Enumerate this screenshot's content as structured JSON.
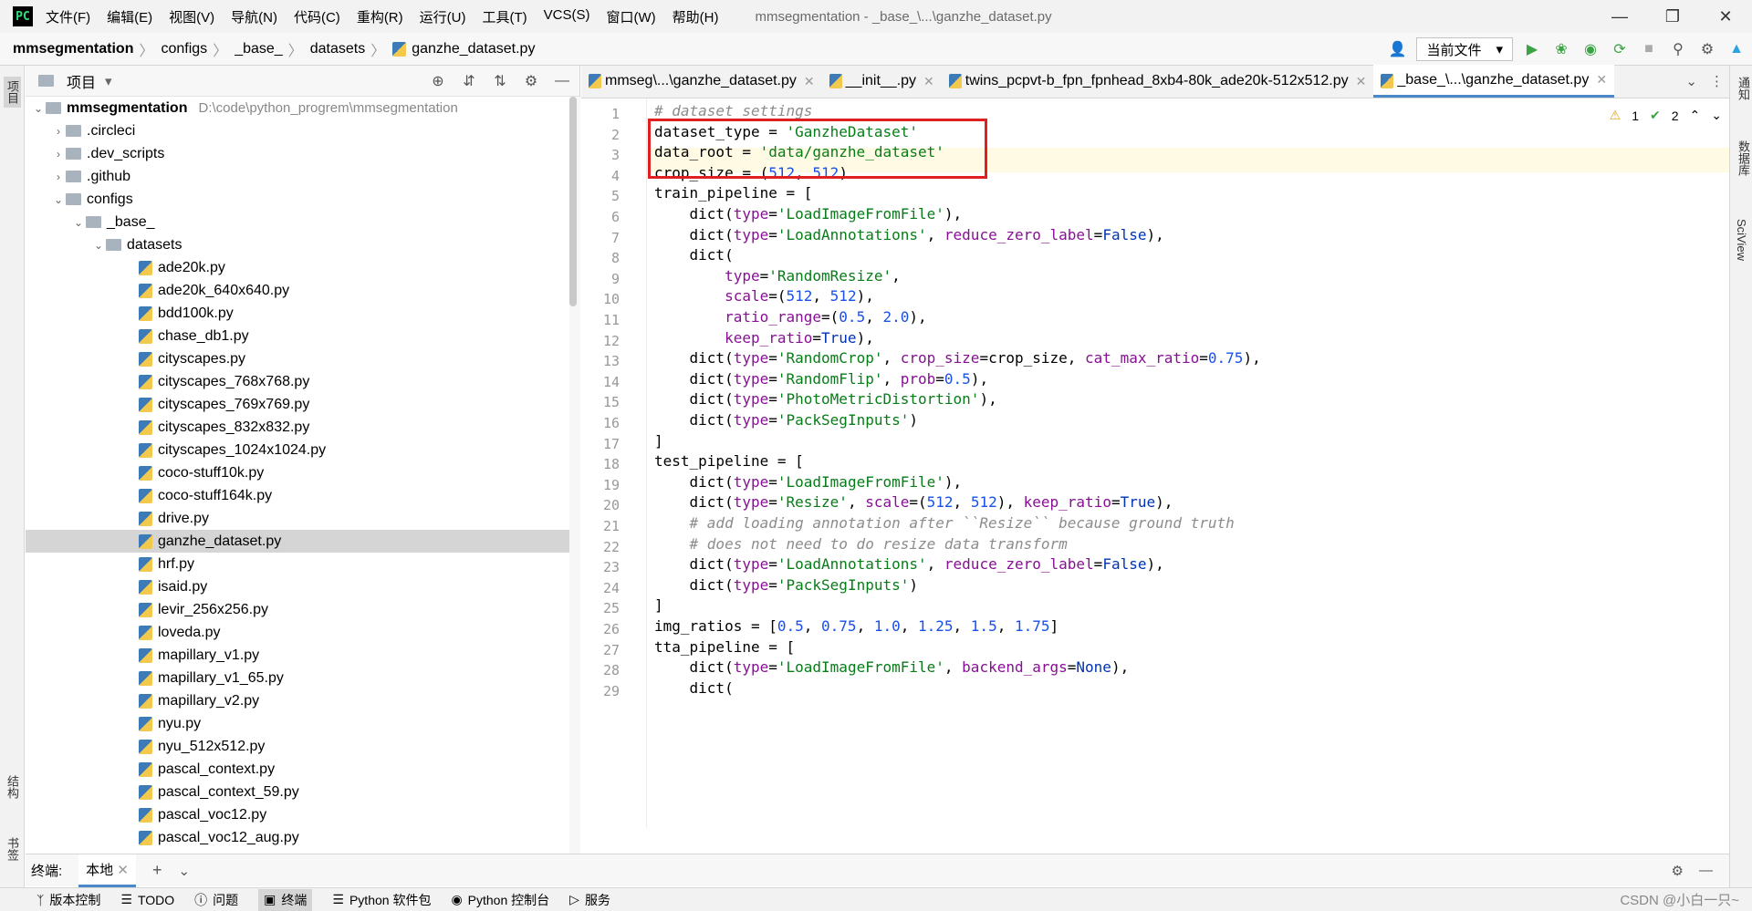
{
  "window": {
    "title": "mmsegmentation - _base_\\...\\ganzhe_dataset.py",
    "menu": [
      "文件(F)",
      "编辑(E)",
      "视图(V)",
      "导航(N)",
      "代码(C)",
      "重构(R)",
      "运行(U)",
      "工具(T)",
      "VCS(S)",
      "窗口(W)",
      "帮助(H)"
    ]
  },
  "breadcrumb": [
    "mmsegmentation",
    "configs",
    "_base_",
    "datasets",
    "ganzhe_dataset.py"
  ],
  "toolbar": {
    "run_config": "当前文件"
  },
  "left_strip": {
    "project": "项目",
    "structure": "结构",
    "bookmarks": "书签"
  },
  "right_strip": {
    "notifications": "通知",
    "database": "数据库",
    "sciview": "SciView"
  },
  "project_panel": {
    "title": "项目",
    "root": {
      "name": "mmsegmentation",
      "path": "D:\\code\\python_progrem\\mmsegmentation"
    },
    "folders": [
      ".circleci",
      ".dev_scripts",
      ".github",
      "configs",
      "_base_",
      "datasets"
    ],
    "files": [
      "ade20k.py",
      "ade20k_640x640.py",
      "bdd100k.py",
      "chase_db1.py",
      "cityscapes.py",
      "cityscapes_768x768.py",
      "cityscapes_769x769.py",
      "cityscapes_832x832.py",
      "cityscapes_1024x1024.py",
      "coco-stuff10k.py",
      "coco-stuff164k.py",
      "drive.py",
      "ganzhe_dataset.py",
      "hrf.py",
      "isaid.py",
      "levir_256x256.py",
      "loveda.py",
      "mapillary_v1.py",
      "mapillary_v1_65.py",
      "mapillary_v2.py",
      "nyu.py",
      "nyu_512x512.py",
      "pascal_context.py",
      "pascal_context_59.py",
      "pascal_voc12.py",
      "pascal_voc12_aug.py"
    ],
    "selected": "ganzhe_dataset.py"
  },
  "tabs": [
    {
      "label": "mmseg\\...\\ganzhe_dataset.py",
      "active": false
    },
    {
      "label": "__init__.py",
      "active": false
    },
    {
      "label": "twins_pcpvt-b_fpn_fpnhead_8xb4-80k_ade20k-512x512.py",
      "active": false
    },
    {
      "label": "_base_\\...\\ganzhe_dataset.py",
      "active": true
    }
  ],
  "inspections": {
    "warnings": "1",
    "ok": "2"
  },
  "line_numbers": [
    "1",
    "2",
    "3",
    "4",
    "5",
    "6",
    "7",
    "8",
    "9",
    "10",
    "11",
    "12",
    "13",
    "14",
    "15",
    "16",
    "17",
    "18",
    "19",
    "20",
    "21",
    "22",
    "23",
    "24",
    "25",
    "26",
    "27",
    "28",
    "29"
  ],
  "code_lines": [
    "# dataset settings",
    "dataset_type = 'GanzheDataset'",
    "data_root = 'data/ganzhe_dataset'",
    "crop_size = (512, 512)",
    "train_pipeline = [",
    "    dict(type='LoadImageFromFile'),",
    "    dict(type='LoadAnnotations', reduce_zero_label=False),",
    "    dict(",
    "        type='RandomResize',",
    "        scale=(512, 512),",
    "        ratio_range=(0.5, 2.0),",
    "        keep_ratio=True),",
    "    dict(type='RandomCrop', crop_size=crop_size, cat_max_ratio=0.75),",
    "    dict(type='RandomFlip', prob=0.5),",
    "    dict(type='PhotoMetricDistortion'),",
    "    dict(type='PackSegInputs')",
    "]",
    "test_pipeline = [",
    "    dict(type='LoadImageFromFile'),",
    "    dict(type='Resize', scale=(512, 512), keep_ratio=True),",
    "    # add loading annotation after ``Resize`` because ground truth",
    "    # does not need to do resize data transform",
    "    dict(type='LoadAnnotations', reduce_zero_label=False),",
    "    dict(type='PackSegInputs')",
    "]",
    "img_ratios = [0.5, 0.75, 1.0, 1.25, 1.5, 1.75]",
    "tta_pipeline = [",
    "    dict(type='LoadImageFromFile', backend_args=None),",
    "    dict("
  ],
  "terminal": {
    "label": "终端:",
    "tab": "本地"
  },
  "statusbar": [
    "版本控制",
    "TODO",
    "问题",
    "终端",
    "Python 软件包",
    "Python 控制台",
    "服务"
  ],
  "watermark": "CSDN @小白一只~",
  "colors": {
    "accent": "#4a88c7",
    "highlight_box": "#e02020",
    "string": "#067d17",
    "number": "#1750eb",
    "keyword_arg": "#871094"
  }
}
